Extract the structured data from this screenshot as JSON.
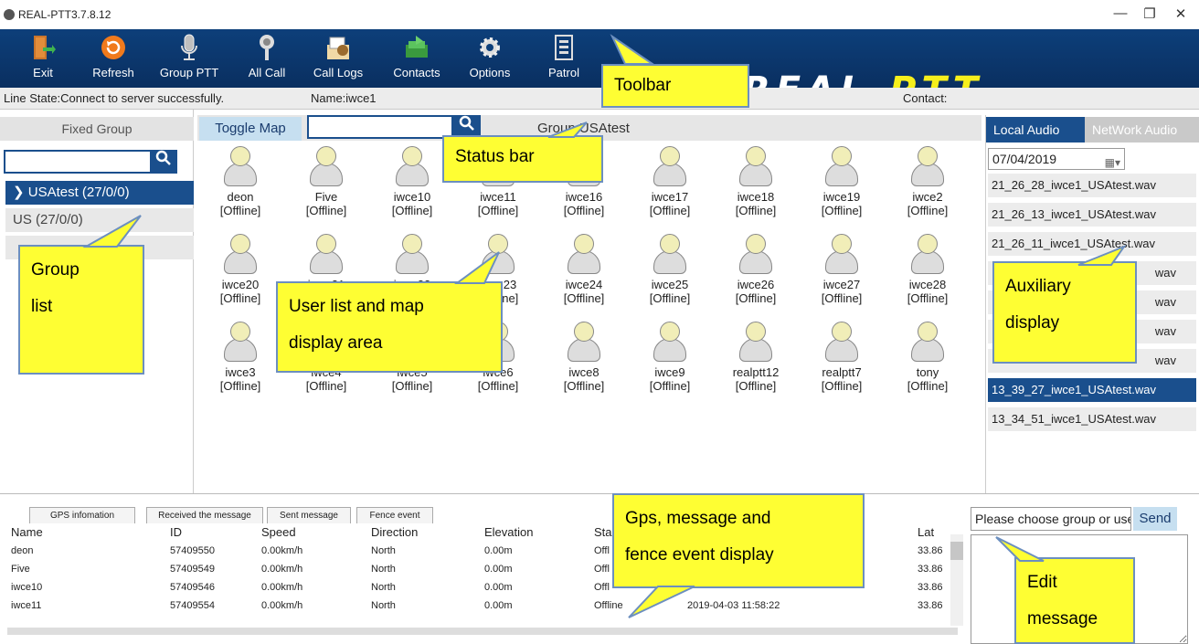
{
  "window": {
    "title": "REAL-PTT3.7.8.12",
    "minimize_glyph": "—",
    "restore_glyph": "❐",
    "close_glyph": "✕"
  },
  "toolbar": {
    "items": [
      {
        "label": "Exit",
        "icon": "exit-door-icon"
      },
      {
        "label": "Refresh",
        "icon": "refresh-icon"
      },
      {
        "label": "Group PTT",
        "icon": "microphone-icon"
      },
      {
        "label": "All Call",
        "icon": "broadcast-icon"
      },
      {
        "label": "Call Logs",
        "icon": "call-logs-icon"
      },
      {
        "label": "Contacts",
        "icon": "contacts-icon"
      },
      {
        "label": "Options",
        "icon": "gear-icon"
      },
      {
        "label": "Patrol",
        "icon": "patrol-icon"
      }
    ],
    "logo_main": "REAL",
    "logo_accent": "-PTT"
  },
  "status": {
    "line_state": "Line State:Connect to server successfully.",
    "name": "Name:iwce1",
    "contact": "Contact:"
  },
  "left_panel": {
    "header": "Fixed Group",
    "search_placeholder": "",
    "groups": [
      {
        "label": "USAtest (27/0/0)",
        "selected": true
      },
      {
        "label": "US (27/0/0)",
        "selected": false
      }
    ]
  },
  "center": {
    "toggle_map": "Toggle Map",
    "search_placeholder": "",
    "group_label": "Group:USAtest",
    "users": [
      {
        "name": "deon",
        "status": "[Offline]"
      },
      {
        "name": "Five",
        "status": "[Offline]"
      },
      {
        "name": "iwce10",
        "status": "[Offline]"
      },
      {
        "name": "iwce11",
        "status": "[Offline]"
      },
      {
        "name": "iwce16",
        "status": "[Offline]"
      },
      {
        "name": "iwce17",
        "status": "[Offline]"
      },
      {
        "name": "iwce18",
        "status": "[Offline]"
      },
      {
        "name": "iwce19",
        "status": "[Offline]"
      },
      {
        "name": "iwce2",
        "status": "[Offline]"
      },
      {
        "name": "iwce20",
        "status": "[Offline]"
      },
      {
        "name": "iwce21",
        "status": "[Offline]"
      },
      {
        "name": "iwce22",
        "status": "[Offline]"
      },
      {
        "name": "iwce23",
        "status": "[Offline]"
      },
      {
        "name": "iwce24",
        "status": "[Offline]"
      },
      {
        "name": "iwce25",
        "status": "[Offline]"
      },
      {
        "name": "iwce26",
        "status": "[Offline]"
      },
      {
        "name": "iwce27",
        "status": "[Offline]"
      },
      {
        "name": "iwce28",
        "status": "[Offline]"
      },
      {
        "name": "iwce3",
        "status": "[Offline]"
      },
      {
        "name": "iwce4",
        "status": "[Offline]"
      },
      {
        "name": "iwce5",
        "status": "[Offline]"
      },
      {
        "name": "iwce6",
        "status": "[Offline]"
      },
      {
        "name": "iwce8",
        "status": "[Offline]"
      },
      {
        "name": "iwce9",
        "status": "[Offline]"
      },
      {
        "name": "realptt12",
        "status": "[Offline]"
      },
      {
        "name": "realptt7",
        "status": "[Offline]"
      },
      {
        "name": "tony",
        "status": "[Offline]"
      }
    ]
  },
  "right_panel": {
    "tab_local": "Local Audio",
    "tab_network": "NetWork Audio",
    "date": "07/04/2019",
    "files": [
      {
        "label": "21_26_28_iwce1_USAtest.wav",
        "selected": false
      },
      {
        "label": "21_26_13_iwce1_USAtest.wav",
        "selected": false
      },
      {
        "label": "21_26_11_iwce1_USAtest.wav",
        "selected": false
      },
      {
        "label": "wav",
        "selected": false
      },
      {
        "label": "wav",
        "selected": false
      },
      {
        "label": "wav",
        "selected": false
      },
      {
        "label": "wav",
        "selected": false
      },
      {
        "label": "13_39_27_iwce1_USAtest.wav",
        "selected": true
      },
      {
        "label": "13_34_51_iwce1_USAtest.wav",
        "selected": false
      }
    ]
  },
  "bottom": {
    "tabs": [
      "GPS infomation",
      "Received the message",
      "Sent message",
      "Fence event"
    ],
    "columns": [
      "Name",
      "ID",
      "Speed",
      "Direction",
      "Elevation",
      "Sta",
      "Lat"
    ],
    "rows": [
      {
        "name": "deon",
        "id": "57409550",
        "speed": "0.00km/h",
        "direction": "North",
        "elevation": "0.00m",
        "state": "Offl",
        "time": "",
        "lat": "33.86"
      },
      {
        "name": "Five",
        "id": "57409549",
        "speed": "0.00km/h",
        "direction": "North",
        "elevation": "0.00m",
        "state": "Offl",
        "time": "",
        "lat": "33.86"
      },
      {
        "name": "iwce10",
        "id": "57409546",
        "speed": "0.00km/h",
        "direction": "North",
        "elevation": "0.00m",
        "state": "Offl",
        "time": "",
        "lat": "33.86"
      },
      {
        "name": "iwce11",
        "id": "57409554",
        "speed": "0.00km/h",
        "direction": "North",
        "elevation": "0.00m",
        "state": "Offline",
        "time": "2019-04-03 11:58:22",
        "lat": "33.86"
      }
    ],
    "message_target": "Please choose group or user",
    "send": "Send"
  },
  "callouts": {
    "toolbar": "Toolbar",
    "status_bar": "Status bar",
    "group_list_1": "Group",
    "group_list_2": "list",
    "user_list_1": "User list and map",
    "user_list_2": "display area",
    "aux_1": "Auxiliary",
    "aux_2": "display",
    "gps_1": "Gps, message and",
    "gps_2": "fence event display",
    "edit_1": "Edit",
    "edit_2": "message"
  },
  "colors": {
    "toolbar_bg": "#0d3f7a",
    "selected_blue": "#1a4f8d",
    "callout_yellow": "#fefe33",
    "logo_accent": "#f6ef1c"
  }
}
